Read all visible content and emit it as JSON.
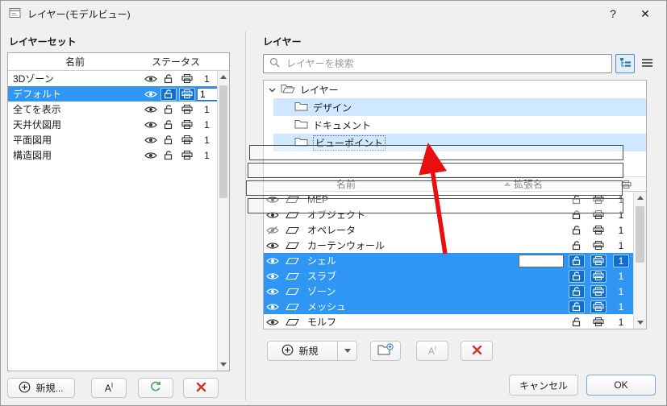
{
  "titlebar": {
    "title": "レイヤー(モデルビュー)",
    "help_glyph": "?",
    "close_glyph": "✕"
  },
  "left_panel": {
    "heading": "レイヤーセット",
    "columns": {
      "name": "名前",
      "status": "ステータス"
    },
    "rows": [
      {
        "name": "3Dゾーン",
        "count": "1",
        "selected": false
      },
      {
        "name": "デフォルト",
        "count": "1",
        "selected": true
      },
      {
        "name": "全てを表示",
        "count": "1",
        "selected": false
      },
      {
        "name": "天井伏図用",
        "count": "1",
        "selected": false
      },
      {
        "name": "平面図用",
        "count": "1",
        "selected": false
      },
      {
        "name": "構造図用",
        "count": "1",
        "selected": false
      }
    ],
    "buttons": {
      "new": "新規...",
      "rename_main": "A",
      "rename_sup": "I"
    }
  },
  "right_panel": {
    "heading": "レイヤー",
    "search": {
      "placeholder": "レイヤーを検索"
    },
    "tree": {
      "root": "レイヤー",
      "children": [
        {
          "label": "デザイン",
          "highlighted": true
        },
        {
          "label": "ドキュメント",
          "highlighted": false
        },
        {
          "label": "ビューポイント",
          "highlighted": true
        }
      ]
    },
    "columns": {
      "name": "名前",
      "ext": "拡張名"
    },
    "rows": [
      {
        "name": "MEP",
        "count": "1",
        "selected": false
      },
      {
        "name": "オブジェクト",
        "count": "1",
        "selected": false
      },
      {
        "name": "オペレータ",
        "count": "1",
        "selected": false,
        "hidden": true
      },
      {
        "name": "カーテンウォール",
        "count": "1",
        "selected": false
      },
      {
        "name": "シェル",
        "count": "1",
        "selected": true,
        "ext_edit": ""
      },
      {
        "name": "スラブ",
        "count": "1",
        "selected": true
      },
      {
        "name": "ゾーン",
        "count": "1",
        "selected": true
      },
      {
        "name": "メッシュ",
        "count": "1",
        "selected": true
      },
      {
        "name": "モルフ",
        "count": "1",
        "selected": false
      }
    ],
    "buttons": {
      "new": "新規",
      "rename_main": "A",
      "rename_sup": "I"
    }
  },
  "footer": {
    "cancel": "キャンセル",
    "ok": "OK"
  },
  "accent_colors": {
    "selection_blue": "#2f96f3",
    "highlight_blue": "#cfe8ff",
    "arrow_red": "#e90f0f"
  }
}
